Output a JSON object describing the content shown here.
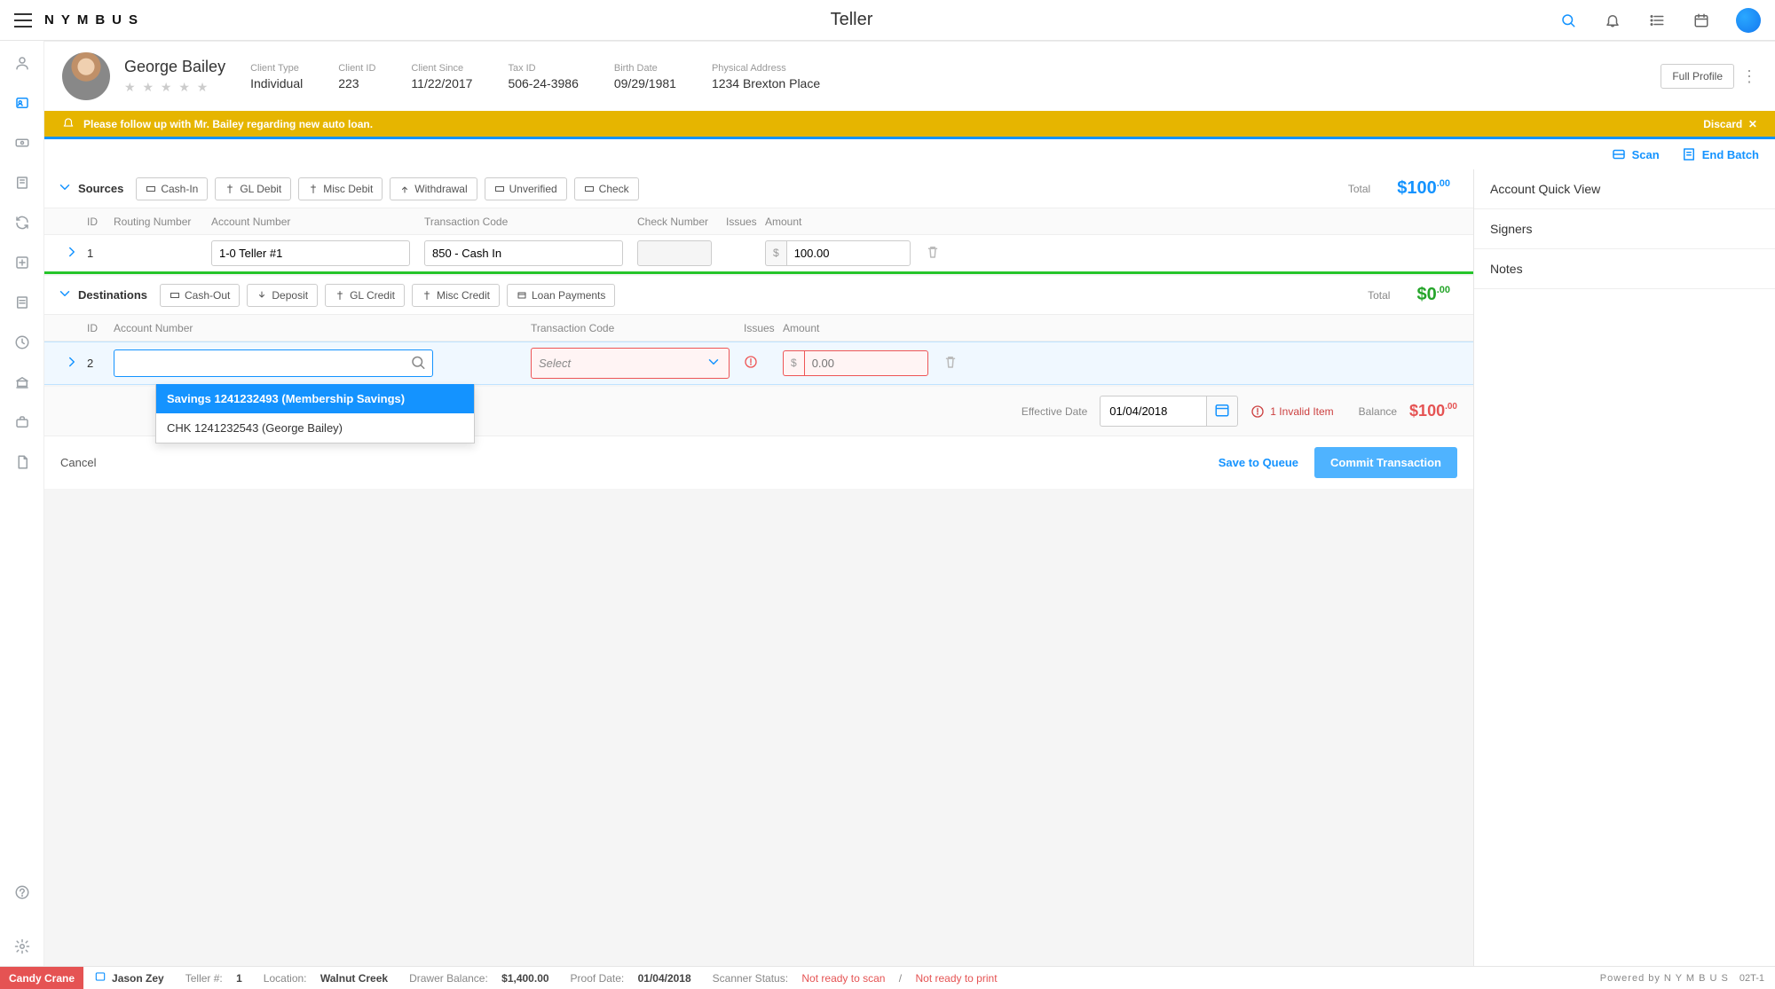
{
  "brand": "NYMBUS",
  "page_title": "Teller",
  "client": {
    "name": "George Bailey",
    "meta": {
      "client_type": {
        "label": "Client Type",
        "value": "Individual"
      },
      "client_id": {
        "label": "Client ID",
        "value": "223"
      },
      "client_since": {
        "label": "Client Since",
        "value": "11/22/2017"
      },
      "tax_id": {
        "label": "Tax ID",
        "value": "506-24-3986"
      },
      "birth_date": {
        "label": "Birth Date",
        "value": "09/29/1981"
      },
      "address": {
        "label": "Physical Address",
        "value": "1234 Brexton Place"
      }
    },
    "full_profile_label": "Full Profile"
  },
  "alert": {
    "text": "Please follow up with Mr. Bailey regarding new auto loan.",
    "discard": "Discard"
  },
  "scan_row": {
    "scan": "Scan",
    "end_batch": "End Batch"
  },
  "sources": {
    "title": "Sources",
    "pills": {
      "cash_in": "Cash-In",
      "gl_debit": "GL Debit",
      "misc_debit": "Misc Debit",
      "withdrawal": "Withdrawal",
      "unverified": "Unverified",
      "check": "Check"
    },
    "total_label": "Total",
    "total_whole": "$100",
    "total_cents": ".00",
    "headers": {
      "id": "ID",
      "routing": "Routing Number",
      "account": "Account Number",
      "tcode": "Transaction Code",
      "check": "Check Number",
      "issues": "Issues",
      "amount": "Amount"
    },
    "row1": {
      "id": "1",
      "account": "1-0 Teller #1",
      "tcode": "850 - Cash In",
      "amount": "100.00"
    }
  },
  "destinations": {
    "title": "Destinations",
    "pills": {
      "cash_out": "Cash-Out",
      "deposit": "Deposit",
      "gl_credit": "GL Credit",
      "misc_credit": "Misc Credit",
      "loan_payments": "Loan Payments"
    },
    "total_label": "Total",
    "total_whole": "$0",
    "total_cents": ".00",
    "headers": {
      "id": "ID",
      "account": "Account Number",
      "tcode": "Transaction Code",
      "issues": "Issues",
      "amount": "Amount"
    },
    "row2": {
      "id": "2",
      "tcode_placeholder": "Select",
      "amount_placeholder": "0.00"
    },
    "dropdown": {
      "opt1": "Savings 1241232493 (Membership Savings)",
      "opt2": "CHK 1241232543 (George Bailey)"
    }
  },
  "summary": {
    "eff_date_label": "Effective Date",
    "eff_date": "01/04/2018",
    "invalid": "1 Invalid Item",
    "balance_label": "Balance",
    "balance_whole": "$100",
    "balance_cents": ".00"
  },
  "actions": {
    "cancel": "Cancel",
    "save_queue": "Save to Queue",
    "commit": "Commit Transaction"
  },
  "side_panel": {
    "quick_view": "Account Quick View",
    "signers": "Signers",
    "notes": "Notes"
  },
  "status": {
    "chip": "Candy Crane",
    "user": "Jason Zey",
    "teller_no_label": "Teller #:",
    "teller_no": "1",
    "location_label": "Location:",
    "location": "Walnut Creek",
    "drawer_label": "Drawer Balance:",
    "drawer": "$1,400.00",
    "proof_label": "Proof Date:",
    "proof": "01/04/2018",
    "scanner_label": "Scanner Status:",
    "scanner_err1": "Not ready to scan",
    "scanner_sep": "/",
    "scanner_err2": "Not ready to print",
    "powered": "Powered by N Y M B U S",
    "edge": "02T-1"
  }
}
